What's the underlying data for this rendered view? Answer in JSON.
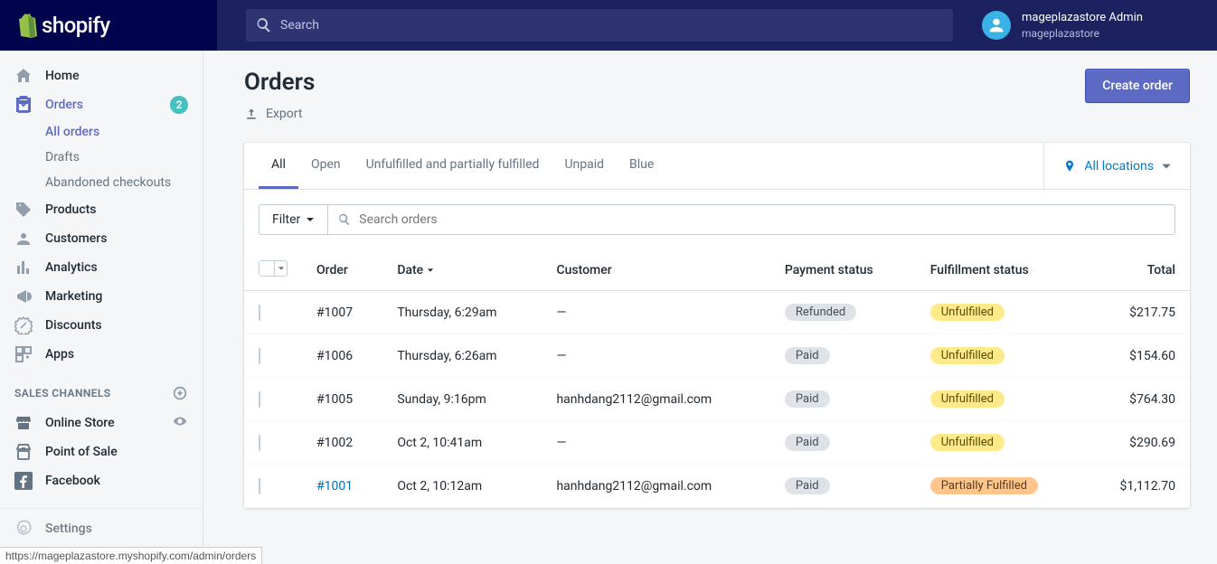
{
  "brand": "shopify",
  "search_placeholder": "Search",
  "user": {
    "name": "mageplazastore Admin",
    "store": "mageplazastore"
  },
  "sidebar": {
    "items": [
      {
        "label": "Home"
      },
      {
        "label": "Orders",
        "badge": "2"
      },
      {
        "label": "Products"
      },
      {
        "label": "Customers"
      },
      {
        "label": "Analytics"
      },
      {
        "label": "Marketing"
      },
      {
        "label": "Discounts"
      },
      {
        "label": "Apps"
      }
    ],
    "orders_sub": [
      {
        "label": "All orders"
      },
      {
        "label": "Drafts"
      },
      {
        "label": "Abandoned checkouts"
      }
    ],
    "section_title": "SALES CHANNELS",
    "channels": [
      {
        "label": "Online Store"
      },
      {
        "label": "Point of Sale"
      },
      {
        "label": "Facebook"
      }
    ],
    "settings": "Settings"
  },
  "page": {
    "title": "Orders",
    "export": "Export",
    "create": "Create order",
    "tabs": [
      "All",
      "Open",
      "Unfulfilled and partially fulfilled",
      "Unpaid",
      "Blue"
    ],
    "locations": "All locations",
    "filter": "Filter",
    "search_placeholder": "Search orders",
    "columns": {
      "order": "Order",
      "date": "Date",
      "customer": "Customer",
      "payment": "Payment status",
      "fulfillment": "Fulfillment status",
      "total": "Total"
    },
    "rows": [
      {
        "order": "#1007",
        "date": "Thursday, 6:29am",
        "customer": "—",
        "payment": "Refunded",
        "payment_cls": "default",
        "fulfillment": "Unfulfilled",
        "fulfillment_cls": "attention",
        "total": "$217.75",
        "link": false
      },
      {
        "order": "#1006",
        "date": "Thursday, 6:26am",
        "customer": "—",
        "payment": "Paid",
        "payment_cls": "default",
        "fulfillment": "Unfulfilled",
        "fulfillment_cls": "attention",
        "total": "$154.60",
        "link": false
      },
      {
        "order": "#1005",
        "date": "Sunday, 9:16pm",
        "customer": "hanhdang2112@gmail.com",
        "payment": "Paid",
        "payment_cls": "default",
        "fulfillment": "Unfulfilled",
        "fulfillment_cls": "attention",
        "total": "$764.30",
        "link": false
      },
      {
        "order": "#1002",
        "date": "Oct 2, 10:41am",
        "customer": "—",
        "payment": "Paid",
        "payment_cls": "default",
        "fulfillment": "Unfulfilled",
        "fulfillment_cls": "attention",
        "total": "$290.69",
        "link": false
      },
      {
        "order": "#1001",
        "date": "Oct 2, 10:12am",
        "customer": "hanhdang2112@gmail.com",
        "payment": "Paid",
        "payment_cls": "default",
        "fulfillment": "Partially Fulfilled",
        "fulfillment_cls": "warning",
        "total": "$1,112.70",
        "link": true
      }
    ]
  },
  "status_url": "https://mageplazastore.myshopify.com/admin/orders"
}
